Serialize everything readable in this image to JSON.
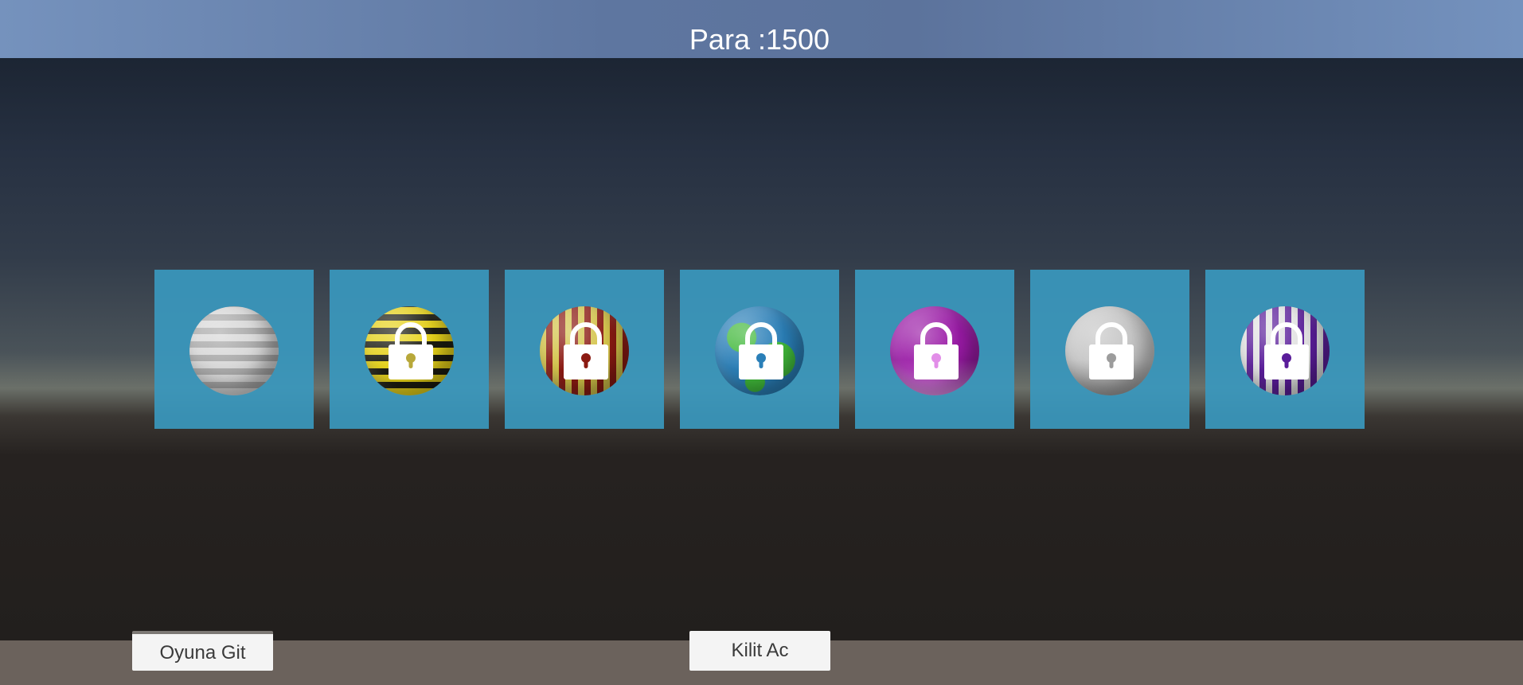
{
  "hud": {
    "money_label": "Para :1500"
  },
  "shop": {
    "items": [
      {
        "name": "silver-striped-ball",
        "locked": false,
        "pattern": "horizontal",
        "colors": [
          "#d8d8d8",
          "#a9a9a9"
        ]
      },
      {
        "name": "yellow-black-ball",
        "locked": true,
        "pattern": "horizontal",
        "colors": [
          "#e6d21a",
          "#1c1c10"
        ]
      },
      {
        "name": "red-yellow-ball",
        "locked": true,
        "pattern": "vertical",
        "colors": [
          "#d4c44a",
          "#8b1a12"
        ]
      },
      {
        "name": "green-blue-ball",
        "locked": true,
        "pattern": "earth",
        "colors": [
          "#40b83a",
          "#2a7fb8"
        ]
      },
      {
        "name": "purple-ball",
        "locked": true,
        "pattern": "solid",
        "colors": [
          "#9a1aa6",
          "#e28ee8"
        ]
      },
      {
        "name": "grey-ball",
        "locked": true,
        "pattern": "solid",
        "colors": [
          "#c6c6c6",
          "#9c9c9c"
        ]
      },
      {
        "name": "purple-white-ball",
        "locked": true,
        "pattern": "vertical",
        "colors": [
          "#e2e2e2",
          "#5a1d9a"
        ]
      }
    ],
    "lock_icon": "padlock-icon"
  },
  "buttons": {
    "play_label": "Oyuna Git",
    "unlock_label": "Kilit Ac"
  }
}
